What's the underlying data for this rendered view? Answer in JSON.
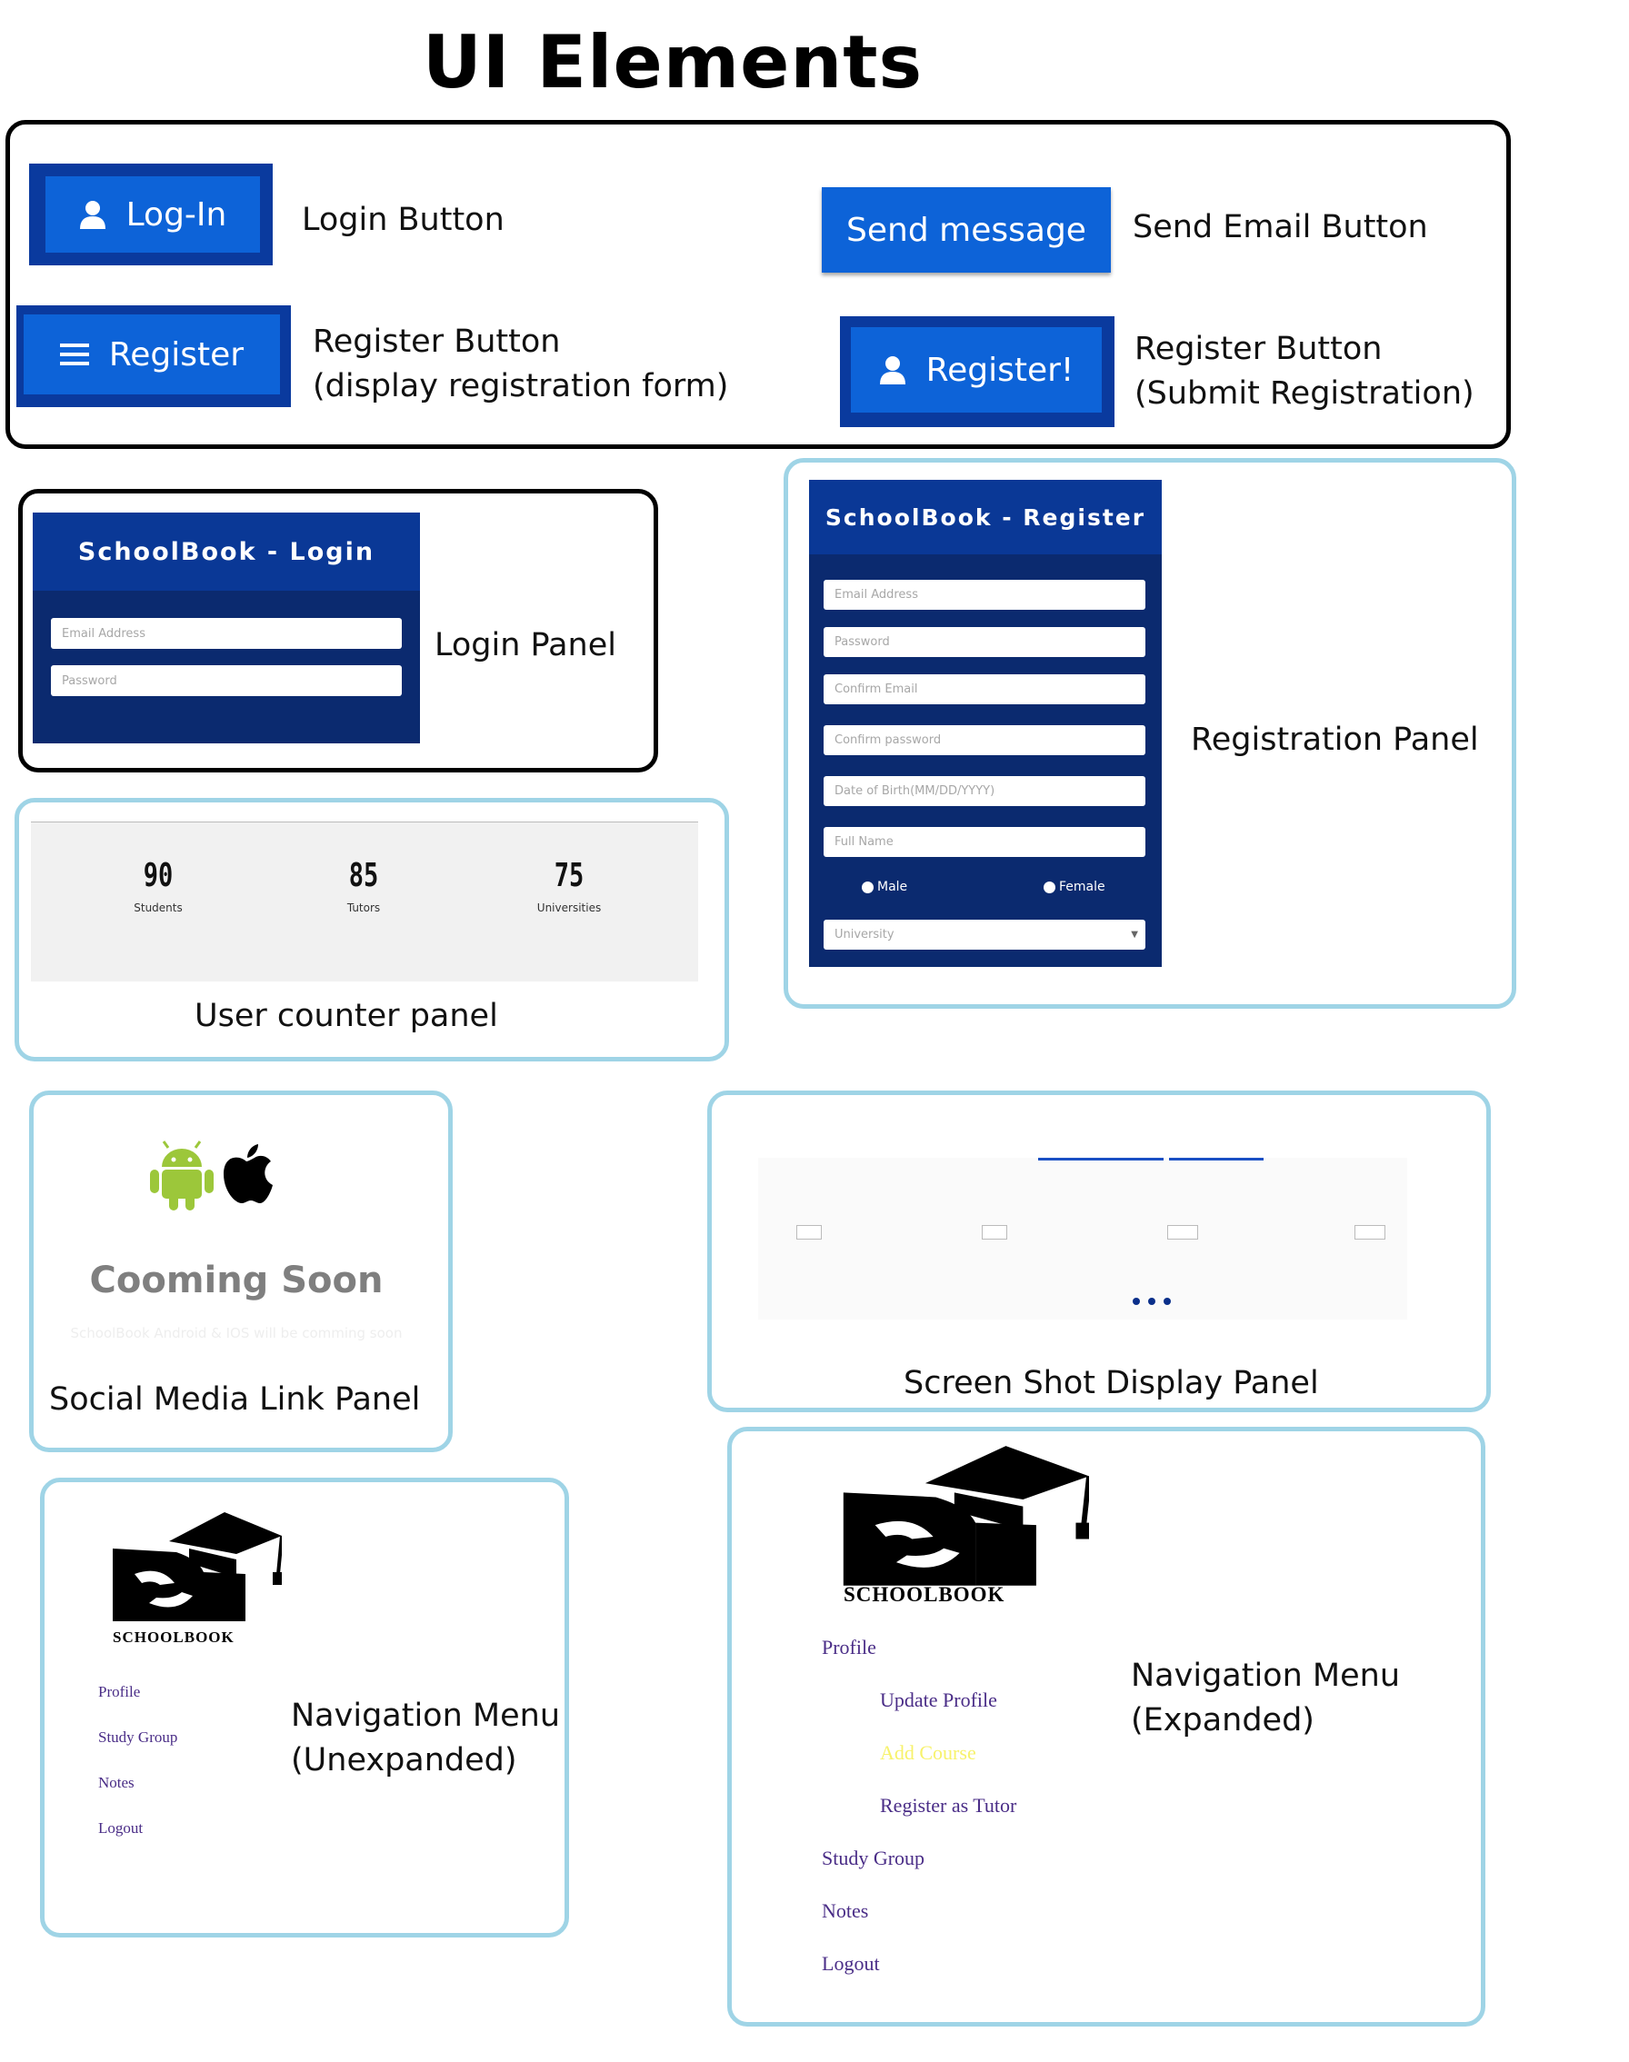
{
  "title": "UI Elements",
  "buttons": {
    "login": {
      "label": "Log-In",
      "icon": "user-icon",
      "caption": "Login Button"
    },
    "register": {
      "label": "Register",
      "icon": "hamburger-icon",
      "caption_line1": "Register Button",
      "caption_line2": "(display registration form)"
    },
    "send": {
      "label": "Send message",
      "caption": "Send Email  Button"
    },
    "register_submit": {
      "label": "Register!",
      "icon": "user-icon",
      "caption_line1": "Register Button",
      "caption_line2": "(Submit Registration)"
    }
  },
  "login_panel": {
    "header": "SchoolBook - Login",
    "email_placeholder": "Email Address",
    "password_placeholder": "Password",
    "caption": "Login Panel"
  },
  "register_panel": {
    "header": "SchoolBook - Register",
    "fields": [
      "Email Address",
      "Password",
      "Confirm Email",
      "Confirm password",
      "Date of Birth(MM/DD/YYYY)",
      "Full Name"
    ],
    "gender": [
      "Male",
      "Female"
    ],
    "university_placeholder": "University",
    "caption": "Registration Panel"
  },
  "counter_panel": {
    "items": [
      {
        "value": "90",
        "label": "Students"
      },
      {
        "value": "85",
        "label": "Tutors"
      },
      {
        "value": "75",
        "label": "Universities"
      }
    ],
    "caption": "User counter panel"
  },
  "social_panel": {
    "icons": [
      "android-icon",
      "apple-icon"
    ],
    "heading": "Cooming Soon",
    "subtext": "SchoolBook Android & IOS will be comming soon",
    "caption": "Social Media Link Panel"
  },
  "screenshot_panel": {
    "caption": "Screen Shot Display Panel",
    "images": [
      "broken-image-icon",
      "broken-image-icon",
      "broken-image-icon",
      "broken-image-icon"
    ]
  },
  "nav_unexpanded": {
    "logo_text": "SCHOOLBOOK",
    "items": [
      "Profile",
      "Study Group",
      "Notes",
      "Logout"
    ],
    "caption_line1": "Navigation Menu",
    "caption_line2": "(Unexpanded)"
  },
  "nav_expanded": {
    "logo_text": "SCHOOLBOOK",
    "profile": "Profile",
    "sub_items": [
      "Update Profile",
      "Add Course",
      "Register as Tutor"
    ],
    "items": [
      "Study Group",
      "Notes",
      "Logout"
    ],
    "caption_line1": "Navigation Menu",
    "caption_line2": "(Expanded)"
  },
  "colors": {
    "button_blue": "#0d63d8",
    "panel_navy": "#0b2a6f",
    "nav_purple": "#4a2d87",
    "highlight_yellow": "#f7f26b"
  }
}
